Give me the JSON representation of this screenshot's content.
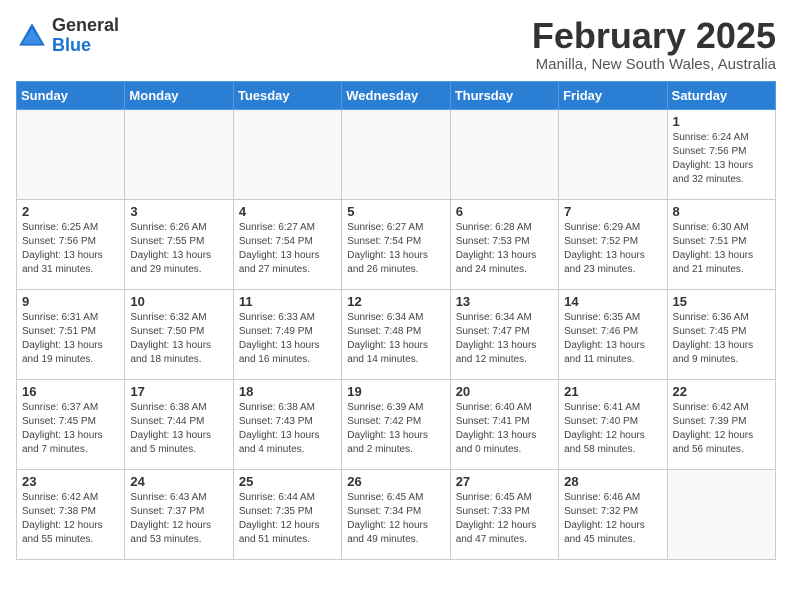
{
  "header": {
    "logo_general": "General",
    "logo_blue": "Blue",
    "month_title": "February 2025",
    "location": "Manilla, New South Wales, Australia"
  },
  "days_of_week": [
    "Sunday",
    "Monday",
    "Tuesday",
    "Wednesday",
    "Thursday",
    "Friday",
    "Saturday"
  ],
  "weeks": [
    [
      {
        "day": null
      },
      {
        "day": null
      },
      {
        "day": null
      },
      {
        "day": null
      },
      {
        "day": null
      },
      {
        "day": null
      },
      {
        "day": 1,
        "sunrise": "6:24 AM",
        "sunset": "7:56 PM",
        "daylight": "13 hours and 32 minutes."
      }
    ],
    [
      {
        "day": 2,
        "sunrise": "6:25 AM",
        "sunset": "7:56 PM",
        "daylight": "13 hours and 31 minutes."
      },
      {
        "day": 3,
        "sunrise": "6:26 AM",
        "sunset": "7:55 PM",
        "daylight": "13 hours and 29 minutes."
      },
      {
        "day": 4,
        "sunrise": "6:27 AM",
        "sunset": "7:54 PM",
        "daylight": "13 hours and 27 minutes."
      },
      {
        "day": 5,
        "sunrise": "6:27 AM",
        "sunset": "7:54 PM",
        "daylight": "13 hours and 26 minutes."
      },
      {
        "day": 6,
        "sunrise": "6:28 AM",
        "sunset": "7:53 PM",
        "daylight": "13 hours and 24 minutes."
      },
      {
        "day": 7,
        "sunrise": "6:29 AM",
        "sunset": "7:52 PM",
        "daylight": "13 hours and 23 minutes."
      },
      {
        "day": 8,
        "sunrise": "6:30 AM",
        "sunset": "7:51 PM",
        "daylight": "13 hours and 21 minutes."
      }
    ],
    [
      {
        "day": 9,
        "sunrise": "6:31 AM",
        "sunset": "7:51 PM",
        "daylight": "13 hours and 19 minutes."
      },
      {
        "day": 10,
        "sunrise": "6:32 AM",
        "sunset": "7:50 PM",
        "daylight": "13 hours and 18 minutes."
      },
      {
        "day": 11,
        "sunrise": "6:33 AM",
        "sunset": "7:49 PM",
        "daylight": "13 hours and 16 minutes."
      },
      {
        "day": 12,
        "sunrise": "6:34 AM",
        "sunset": "7:48 PM",
        "daylight": "13 hours and 14 minutes."
      },
      {
        "day": 13,
        "sunrise": "6:34 AM",
        "sunset": "7:47 PM",
        "daylight": "13 hours and 12 minutes."
      },
      {
        "day": 14,
        "sunrise": "6:35 AM",
        "sunset": "7:46 PM",
        "daylight": "13 hours and 11 minutes."
      },
      {
        "day": 15,
        "sunrise": "6:36 AM",
        "sunset": "7:45 PM",
        "daylight": "13 hours and 9 minutes."
      }
    ],
    [
      {
        "day": 16,
        "sunrise": "6:37 AM",
        "sunset": "7:45 PM",
        "daylight": "13 hours and 7 minutes."
      },
      {
        "day": 17,
        "sunrise": "6:38 AM",
        "sunset": "7:44 PM",
        "daylight": "13 hours and 5 minutes."
      },
      {
        "day": 18,
        "sunrise": "6:38 AM",
        "sunset": "7:43 PM",
        "daylight": "13 hours and 4 minutes."
      },
      {
        "day": 19,
        "sunrise": "6:39 AM",
        "sunset": "7:42 PM",
        "daylight": "13 hours and 2 minutes."
      },
      {
        "day": 20,
        "sunrise": "6:40 AM",
        "sunset": "7:41 PM",
        "daylight": "13 hours and 0 minutes."
      },
      {
        "day": 21,
        "sunrise": "6:41 AM",
        "sunset": "7:40 PM",
        "daylight": "12 hours and 58 minutes."
      },
      {
        "day": 22,
        "sunrise": "6:42 AM",
        "sunset": "7:39 PM",
        "daylight": "12 hours and 56 minutes."
      }
    ],
    [
      {
        "day": 23,
        "sunrise": "6:42 AM",
        "sunset": "7:38 PM",
        "daylight": "12 hours and 55 minutes."
      },
      {
        "day": 24,
        "sunrise": "6:43 AM",
        "sunset": "7:37 PM",
        "daylight": "12 hours and 53 minutes."
      },
      {
        "day": 25,
        "sunrise": "6:44 AM",
        "sunset": "7:35 PM",
        "daylight": "12 hours and 51 minutes."
      },
      {
        "day": 26,
        "sunrise": "6:45 AM",
        "sunset": "7:34 PM",
        "daylight": "12 hours and 49 minutes."
      },
      {
        "day": 27,
        "sunrise": "6:45 AM",
        "sunset": "7:33 PM",
        "daylight": "12 hours and 47 minutes."
      },
      {
        "day": 28,
        "sunrise": "6:46 AM",
        "sunset": "7:32 PM",
        "daylight": "12 hours and 45 minutes."
      },
      {
        "day": null
      }
    ]
  ]
}
